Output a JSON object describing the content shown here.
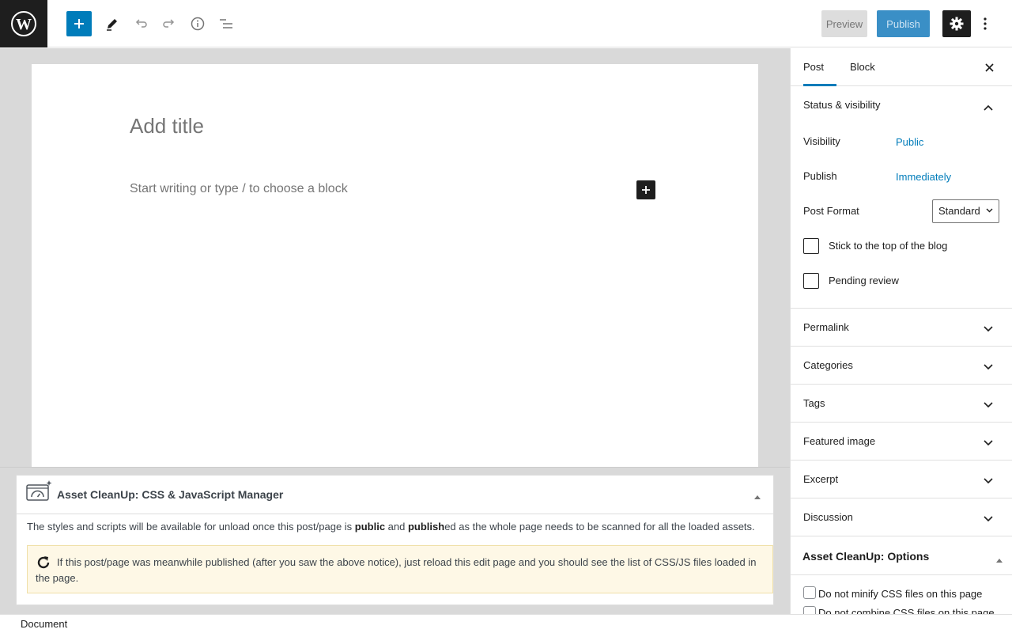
{
  "toolbar": {
    "preview_label": "Preview",
    "publish_label": "Publish"
  },
  "editor": {
    "title_placeholder": "Add title",
    "block_placeholder": "Start writing or type / to choose a block"
  },
  "metabox": {
    "title": "Asset CleanUp: CSS & JavaScript Manager",
    "text_before": "The styles and scripts will be available for unload once this post/page is ",
    "bold_public": "public",
    "text_and": " and ",
    "bold_publish": "publish",
    "text_after": "ed as the whole page needs to be scanned for all the loaded assets.",
    "notice": "If this post/page was meanwhile published (after you saw the above notice), just reload this edit page and you should see the list of CSS/JS files loaded in the page."
  },
  "footer": {
    "breadcrumb": "Document"
  },
  "sidebar": {
    "tabs": [
      {
        "label": "Post",
        "active": true
      },
      {
        "label": "Block",
        "active": false
      }
    ],
    "status_panel": {
      "title": "Status & visibility",
      "visibility_label": "Visibility",
      "visibility_value": "Public",
      "publish_label": "Publish",
      "publish_value": "Immediately",
      "format_label": "Post Format",
      "format_value": "Standard",
      "sticky_label": "Stick to the top of the blog",
      "pending_label": "Pending review"
    },
    "panels": [
      {
        "label": "Permalink"
      },
      {
        "label": "Categories"
      },
      {
        "label": "Tags"
      },
      {
        "label": "Featured image"
      },
      {
        "label": "Excerpt"
      },
      {
        "label": "Discussion"
      }
    ],
    "asset_options": {
      "title": "Asset CleanUp: Options",
      "options": [
        {
          "label": "Do not minify CSS files on this page"
        },
        {
          "label": "Do not combine CSS files on this page"
        }
      ]
    }
  },
  "colors": {
    "accent": "#007cba",
    "dark": "#1e1e1e",
    "notice_bg": "#fef8e6"
  }
}
